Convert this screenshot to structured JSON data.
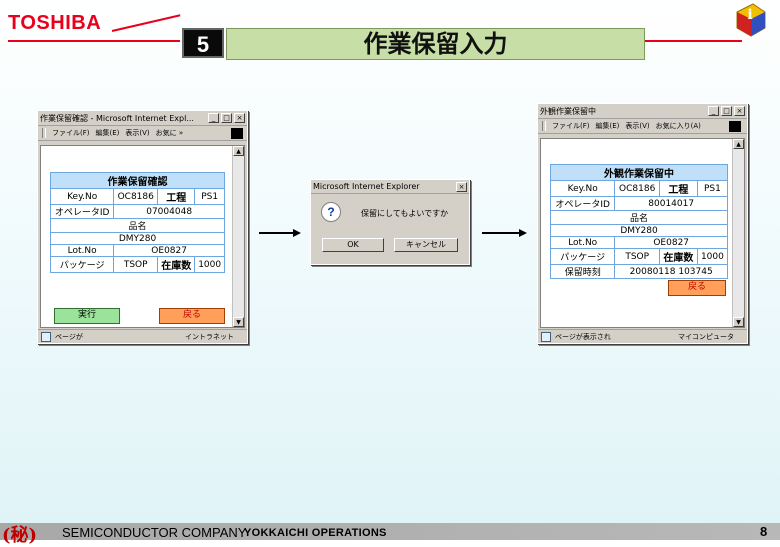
{
  "header": {
    "logo": "TOSHIBA",
    "step_number": "5",
    "title": "作業保留入力"
  },
  "window1": {
    "title": "作業保留確認 - Microsoft Internet Expl...",
    "menu": [
      "ファイル(F)",
      "編集(E)",
      "表示(V)",
      "お気に »"
    ],
    "form_header": "作業保留確認",
    "keyno_label": "Key.No",
    "keyno_value": "OC8186",
    "process_label": "工程",
    "process_value": "PS1",
    "operator_label": "オペレータID",
    "operator_value": "07004048",
    "product_label": "品名",
    "product_value": "DMY280",
    "lotno_label": "Lot.No",
    "lotno_value": "OE0827",
    "package_label": "パッケージ",
    "package_value": "TSOP",
    "stock_label": "在庫数",
    "stock_value": "1000",
    "execute_button": "実行",
    "back_button": "戻る",
    "status_text": "ページが",
    "status_zone": "イントラネット"
  },
  "dialog": {
    "title": "Microsoft Internet Explorer",
    "message": "保留にしてもよいですか",
    "ok_button": "OK",
    "cancel_button": "キャンセル"
  },
  "window2": {
    "title": "外観作業保留中",
    "menu": [
      "ファイル(F)",
      "編集(E)",
      "表示(V)",
      "お気に入り(A)"
    ],
    "form_header": "外観作業保留中",
    "keyno_label": "Key.No",
    "keyno_value": "OC8186",
    "process_label": "工程",
    "process_value": "PS1",
    "operator_label": "オペレータID",
    "operator_value": "80014017",
    "product_label": "品名",
    "product_value": "DMY280",
    "lotno_label": "Lot.No",
    "lotno_value": "OE0827",
    "package_label": "パッケージ",
    "package_value": "TSOP",
    "stock_label": "在庫数",
    "stock_value": "1000",
    "hold_time_label": "保留時刻",
    "hold_time_value": "20080118 103745",
    "back_button": "戻る",
    "status_text": "ページが表示され",
    "status_zone": "マイコンピュータ"
  },
  "footer": {
    "confidential": "(秘)",
    "company": "SEMICONDUCTOR COMPANY",
    "operations": "YOKKAICHI OPERATIONS",
    "page_number": "8"
  },
  "colors": {
    "brand_red": "#e8001c",
    "title_green": "#c7dea6",
    "form_header_blue": "#bfe0f8",
    "execute_green": "#9be39b",
    "back_orange": "#ff9f5a"
  }
}
